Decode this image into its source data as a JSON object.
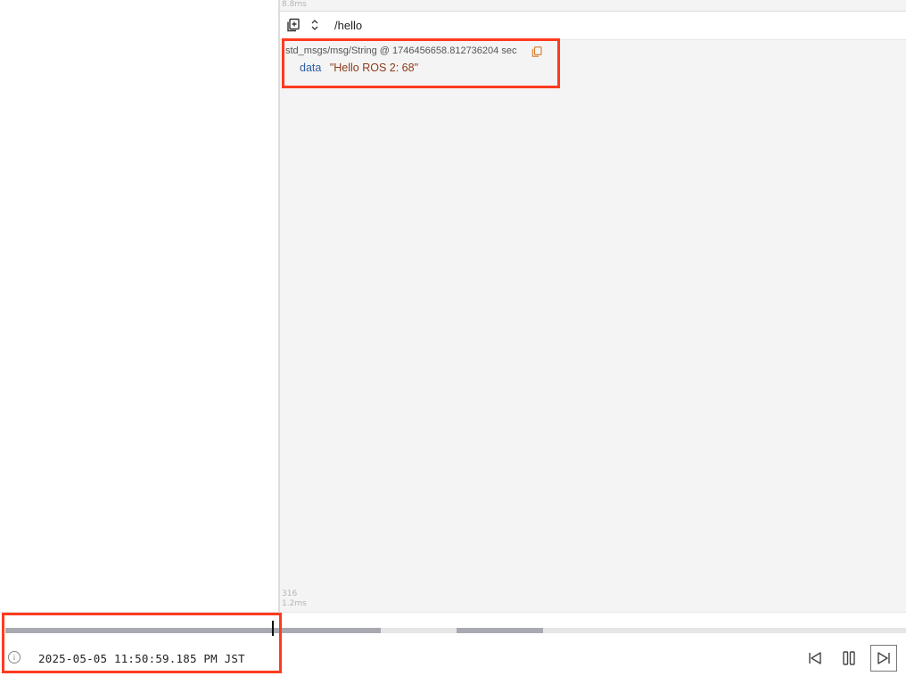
{
  "panel": {
    "perf_top": "8.8ms",
    "topic": "/hello",
    "message": {
      "type_and_time": "std_msgs/msg/String @ 1746456658.812736204 sec",
      "field_key": "data",
      "field_value": "\"Hello ROS 2: 68\""
    },
    "perf_bottom_count": "316",
    "perf_bottom_time": "1.2ms"
  },
  "playback": {
    "timestamp": "2025-05-05 11:50:59.185 PM JST",
    "info_icon_glyph": "i",
    "controls": [
      "seek-back-icon",
      "pause-icon",
      "seek-forward-icon"
    ]
  },
  "colors": {
    "highlight": "#ff3b1f",
    "field_key": "#2f5fa3",
    "field_value": "#8a3b1a",
    "timeline_loaded": "#a9a9b1",
    "timeline_track": "#e6e6e6"
  }
}
